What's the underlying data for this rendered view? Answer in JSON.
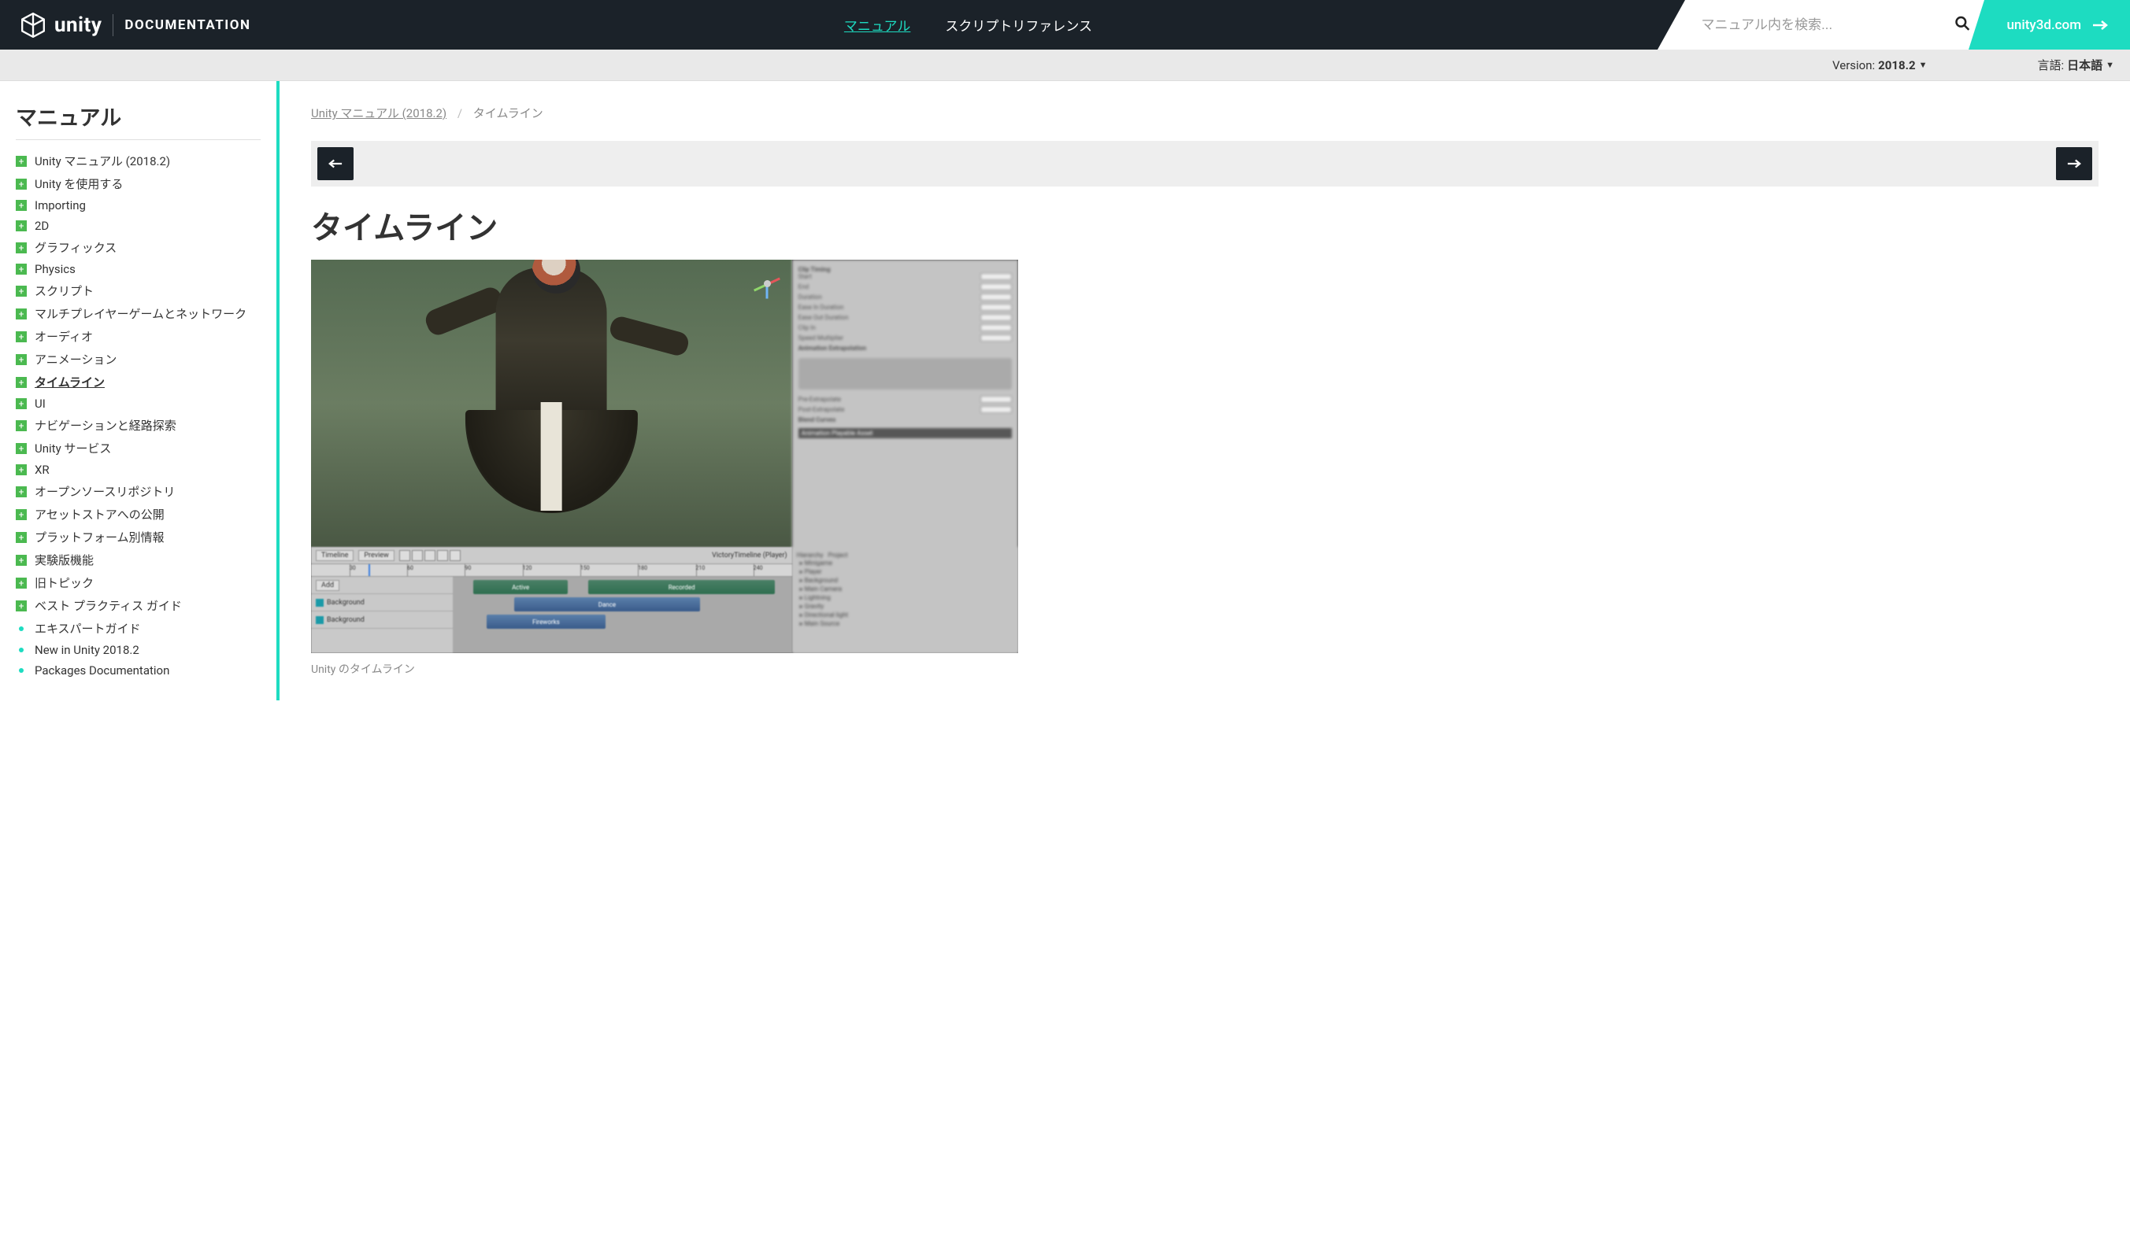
{
  "header": {
    "brand": "unity",
    "doc_label": "DOCUMENTATION",
    "tabs": {
      "manual": "マニュアル",
      "script_ref": "スクリプトリファレンス"
    },
    "search_placeholder": "マニュアル内を検索...",
    "external_link": "unity3d.com"
  },
  "subheader": {
    "version_label": "Version:",
    "version_value": "2018.2",
    "lang_label": "言語:",
    "lang_value": "日本語"
  },
  "sidebar": {
    "title": "マニュアル",
    "items": [
      {
        "icon": "plus",
        "label": "Unity マニュアル (2018.2)"
      },
      {
        "icon": "plus",
        "label": "Unity を使用する"
      },
      {
        "icon": "plus",
        "label": "Importing"
      },
      {
        "icon": "plus",
        "label": "2D"
      },
      {
        "icon": "plus",
        "label": "グラフィックス"
      },
      {
        "icon": "plus",
        "label": "Physics"
      },
      {
        "icon": "plus",
        "label": "スクリプト"
      },
      {
        "icon": "plus",
        "label": "マルチプレイヤーゲームとネットワーク"
      },
      {
        "icon": "plus",
        "label": "オーディオ"
      },
      {
        "icon": "plus",
        "label": "アニメーション"
      },
      {
        "icon": "plus",
        "label": "タイムライン",
        "active": true
      },
      {
        "icon": "plus",
        "label": "UI"
      },
      {
        "icon": "plus",
        "label": "ナビゲーションと経路探索"
      },
      {
        "icon": "plus",
        "label": "Unity サービス"
      },
      {
        "icon": "plus",
        "label": "XR"
      },
      {
        "icon": "plus",
        "label": "オープンソースリポジトリ"
      },
      {
        "icon": "plus",
        "label": "アセットストアへの公開"
      },
      {
        "icon": "plus",
        "label": "プラットフォーム別情報"
      },
      {
        "icon": "plus",
        "label": "実験版機能"
      },
      {
        "icon": "plus",
        "label": "旧トピック"
      },
      {
        "icon": "plus",
        "label": "ベスト プラクティス ガイド"
      },
      {
        "icon": "dot",
        "label": "エキスパートガイド"
      },
      {
        "icon": "dot",
        "label": "New in Unity 2018.2"
      },
      {
        "icon": "dot",
        "label": "Packages Documentation"
      }
    ]
  },
  "breadcrumb": {
    "root": "Unity マニュアル (2018.2)",
    "current": "タイムライン"
  },
  "page": {
    "title": "タイムライン",
    "caption": "Unity のタイムライン"
  },
  "editor": {
    "inspector": {
      "section": "Clip Timing",
      "start": "Start",
      "end": "End",
      "duration": "Duration",
      "ease_in": "Ease In Duration",
      "ease_out": "Ease Out Duration",
      "clip_in": "Clip In",
      "speed": "Speed Multiplier",
      "extrap": "Animation Extrapolation",
      "pre": "Pre-Extrapolate",
      "post": "Post-Extrapolate",
      "blend": "Blend Curves",
      "playable": "Animation Playable Asset"
    },
    "hierarchy": {
      "tab1": "Hierarchy",
      "tab2": "Project",
      "items": [
        "Minigame",
        "Player",
        "Background",
        "Main Camera",
        "Lightning",
        "Gravity",
        "Directional light",
        "Main Source"
      ]
    },
    "timeline": {
      "tab": "Timeline",
      "preview": "Preview",
      "add": "Add",
      "asset": "VictoryTimeline (Player)",
      "frames": [
        "30",
        "60",
        "90",
        "120",
        "150",
        "180",
        "210",
        "240"
      ],
      "track1": "Background",
      "track2": "Background",
      "clip_active": "Active",
      "clip_recorded": "Recorded",
      "clip_dance": "Dance",
      "clip_fire": "Fireworks"
    }
  }
}
